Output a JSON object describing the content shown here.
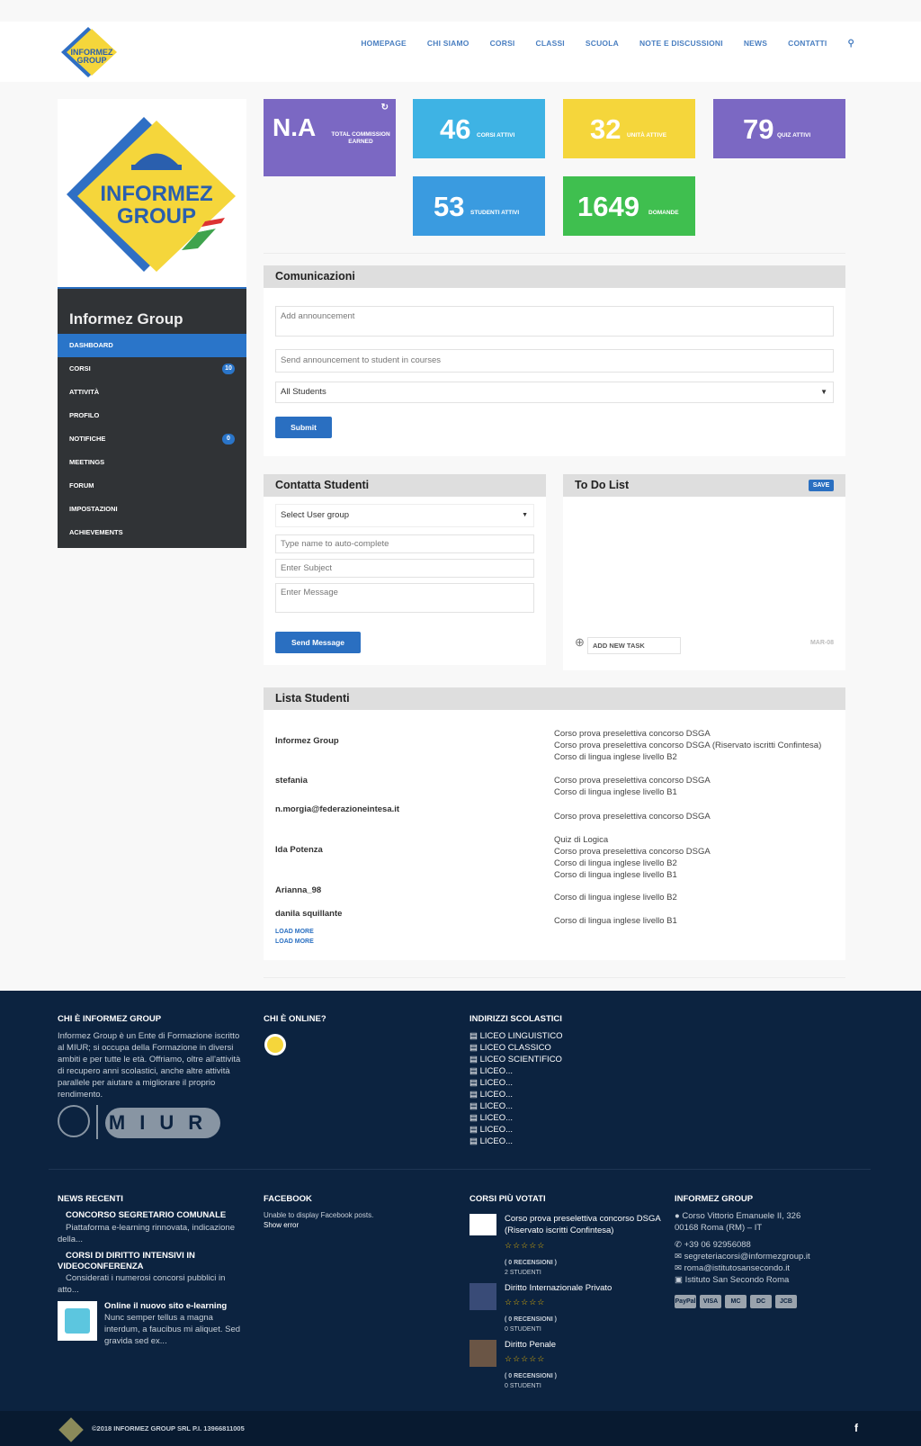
{
  "nav": {
    "items": [
      "HOMEPAGE",
      "CHI SIAMO",
      "CORSI",
      "CLASSI",
      "SCUOLA",
      "NOTE E DISCUSSIONI",
      "NEWS",
      "CONTATTI"
    ]
  },
  "logo": {
    "line1": "INFORMEZ",
    "line2": "GROUP"
  },
  "sidebar": {
    "title": "Informez Group",
    "items": [
      {
        "label": "DASHBOARD"
      },
      {
        "label": "CORSI",
        "badge": "10"
      },
      {
        "label": "ATTIVITÀ"
      },
      {
        "label": "PROFILO"
      },
      {
        "label": "NOTIFICHE",
        "badge": "0"
      },
      {
        "label": "MEETINGS"
      },
      {
        "label": "FORUM"
      },
      {
        "label": "IMPOSTAZIONI"
      },
      {
        "label": "ACHIEVEMENTS"
      }
    ]
  },
  "stats": [
    {
      "num": "N.A",
      "label": "TOTAL COMMISSION EARNED",
      "color": "#7b68c3"
    },
    {
      "num": "46",
      "label": "CORSI ATTIVI",
      "color": "#3eb3e4"
    },
    {
      "num": "32",
      "label": "UNITÀ ATTIVE",
      "color": "#f5d63b"
    },
    {
      "num": "79",
      "label": "QUIZ ATTIVI",
      "color": "#7b68c3"
    },
    {
      "num": "53",
      "label": "STUDENTI ATTIVI",
      "color": "#3a9be0"
    },
    {
      "num": "1649",
      "label": "DOMANDE",
      "color": "#3fbf4f"
    }
  ],
  "comunicazioni": {
    "title": "Comunicazioni",
    "announce_ph": "Add announcement",
    "send_ph": "Send announcement to student in courses",
    "select": "All Students",
    "submit": "Submit"
  },
  "contatta": {
    "title": "Contatta Studenti",
    "group": "Select User group",
    "name_ph": "Type name to auto-complete",
    "subject_ph": "Enter Subject",
    "message_ph": "Enter Message",
    "send": "Send Message"
  },
  "todo": {
    "title": "To Do List",
    "save": "SAVE",
    "add": "ADD NEW TASK",
    "date": "MAR-08"
  },
  "lista": {
    "title": "Lista Studenti",
    "rows": [
      {
        "name": "Informez Group",
        "courses": [
          "Corso prova preselettiva concorso DSGA",
          "Corso prova preselettiva concorso DSGA (Riservato iscritti Confintesa)",
          "Corso di lingua inglese livello B2"
        ]
      },
      {
        "name": "stefania",
        "courses": [
          "Corso prova preselettiva concorso DSGA",
          "Corso di lingua inglese livello B1"
        ]
      },
      {
        "name": "n.morgia@federazioneintesa.it",
        "courses": [
          "Corso prova preselettiva concorso DSGA"
        ]
      },
      {
        "name": "Ida Potenza",
        "courses": [
          "Quiz di Logica",
          "Corso prova preselettiva concorso DSGA",
          "Corso di lingua inglese livello B2",
          "Corso di lingua inglese livello B1"
        ]
      },
      {
        "name": "Arianna_98",
        "courses": [
          "Corso di lingua inglese livello B2"
        ]
      },
      {
        "name": "danila squillante",
        "courses": [
          "Corso di lingua inglese livello B1"
        ]
      }
    ],
    "load_more": "LOAD MORE"
  },
  "footer": {
    "chi_title": "CHI È INFORMEZ GROUP",
    "chi_text": "Informez Group è un Ente di Formazione iscritto al MIUR; si occupa della Formazione in diversi ambiti e per tutte le età. Offriamo, oltre all'attività di recupero anni scolastici, anche altre attività parallele per aiutare a migliorare il proprio rendimento.",
    "miur": "MIUR",
    "online_title": "CHI È ONLINE?",
    "indirizzi_title": "INDIRIZZI SCOLASTICI",
    "indirizzi": [
      "LICEO LINGUISTICO",
      "LICEO CLASSICO",
      "LICEO SCIENTIFICO",
      "LICEO...",
      "LICEO...",
      "LICEO...",
      "LICEO...",
      "LICEO...",
      "LICEO...",
      "LICEO..."
    ],
    "news_title": "NEWS RECENTI",
    "news": [
      {
        "t": "CONCORSO SEGRETARIO COMUNALE",
        "d": "Piattaforma e-learning rinnovata, indicazione della..."
      },
      {
        "t": "CORSI DI DIRITTO INTENSIVI IN VIDEOCONFERENZA",
        "d": "Considerati i numerosi concorsi pubblici in atto..."
      },
      {
        "t": "Online il nuovo sito e-learning",
        "d": "Nunc semper tellus a magna interdum, a faucibus mi aliquet. Sed gravida sed ex..."
      }
    ],
    "fb_title": "FACEBOOK",
    "fb_text": "Unable to display Facebook posts.",
    "fb_err": "Show error",
    "corsi_title": "CORSI PIÙ VOTATI",
    "corsi": [
      {
        "t": "Corso prova preselettiva concorso DSGA (Riservato iscritti Confintesa)",
        "r": "( 0 RECENSIONI )",
        "s": "2 STUDENTI"
      },
      {
        "t": "Diritto Internazionale Privato",
        "r": "( 0 RECENSIONI )",
        "s": "0 STUDENTI"
      },
      {
        "t": "Diritto Penale",
        "r": "( 0 RECENSIONI )",
        "s": "0 STUDENTI"
      }
    ],
    "ig_title": "INFORMEZ GROUP",
    "addr1": "Corso Vittorio Emanuele II, 326",
    "addr2": "00168 Roma (RM) – IT",
    "phone": "+39 06 92956088",
    "mail1": "segreteriacorsi@informezgroup.it",
    "mail2": "roma@istitutosansecondo.it",
    "fbpage": "Istituto San Secondo Roma",
    "payments": [
      "PayPal",
      "VISA",
      "MC",
      "DC",
      "JCB"
    ]
  },
  "copyright": "©2018 INFORMEZ GROUP SRL P.I. 13966811005",
  "fb_icon": "f"
}
